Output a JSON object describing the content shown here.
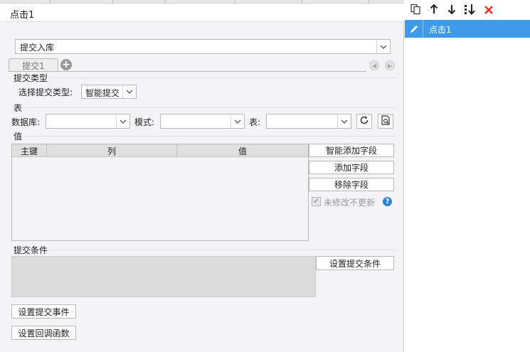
{
  "dialog": {
    "title": "点击1",
    "action_combo": "提交入库",
    "tab_label": "提交1"
  },
  "submit_type": {
    "section": "提交类型",
    "label": "选择提交类型:",
    "value": "智能提交"
  },
  "table_section": {
    "section": "表",
    "db_label": "数据库:",
    "db_value": "",
    "mode_label": "模式:",
    "mode_value": "",
    "table_label": "表:",
    "table_value": ""
  },
  "value_section": {
    "section": "值",
    "columns": [
      "主键",
      "列",
      "值"
    ],
    "rows": [],
    "btn_smart_add": "智能添加字段",
    "btn_add": "添加字段",
    "btn_remove": "移除字段",
    "checkbox_label": "未修改不更新",
    "checkbox_checked": true
  },
  "condition": {
    "section": "提交条件",
    "btn_set": "设置提交条件"
  },
  "events": {
    "btn_event": "设置提交事件",
    "btn_callback": "设置回调函数"
  },
  "right_panel": {
    "items": [
      {
        "label": "点击1",
        "selected": true
      }
    ]
  },
  "colors": {
    "accent": "#3d9be9",
    "delete": "#e0302a",
    "help": "#2b83d6",
    "panel_bg": "#f4f4f6"
  }
}
